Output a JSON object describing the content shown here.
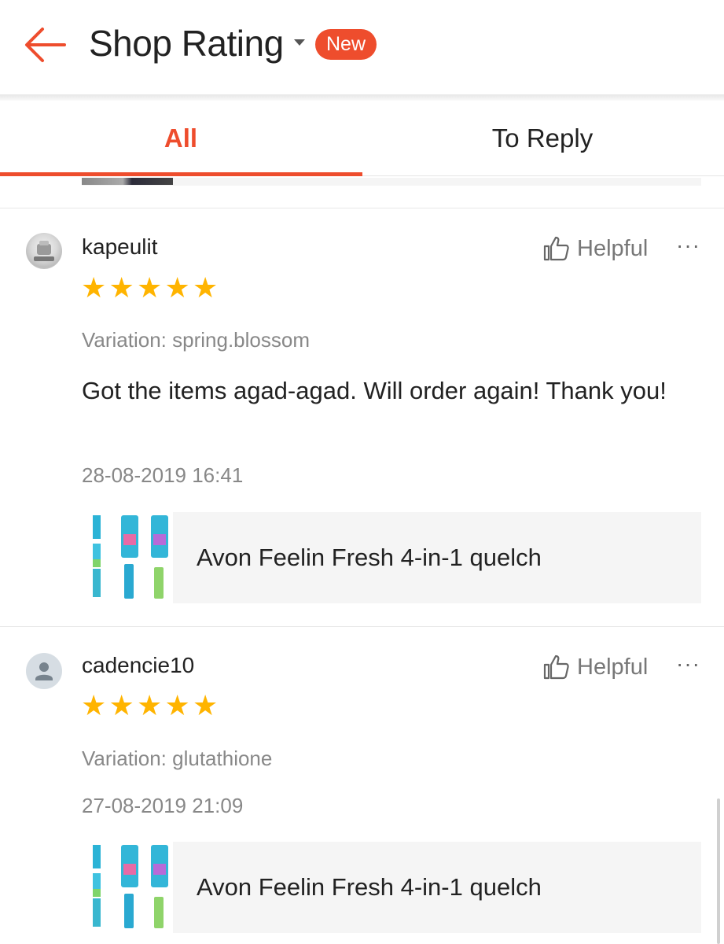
{
  "header": {
    "title": "Shop Rating",
    "badge": "New",
    "accent_color": "#ee4d2d",
    "back_icon": "arrow-left-icon",
    "dropdown_icon": "caret-down-icon"
  },
  "tabs": [
    {
      "label": "All",
      "active": true
    },
    {
      "label": "To Reply",
      "active": false
    }
  ],
  "reviews": [
    {
      "username": "kapeulit",
      "avatar": "user-photo",
      "rating": 5,
      "helpful_label": "Helpful",
      "more_label": "···",
      "variation": "Variation: spring.blossom",
      "comment": "Got the items agad-agad. Will order again! Thank you!",
      "timestamp": "28-08-2019 16:41",
      "product_name": "Avon Feelin Fresh 4-in-1 quelch"
    },
    {
      "username": "cadencie10",
      "avatar": "default-user-icon",
      "rating": 5,
      "helpful_label": "Helpful",
      "more_label": "···",
      "variation": "Variation: glutathione",
      "comment": "",
      "timestamp": "27-08-2019 21:09",
      "product_name": "Avon Feelin Fresh 4-in-1 quelch"
    }
  ],
  "star_color": "#ffb400"
}
